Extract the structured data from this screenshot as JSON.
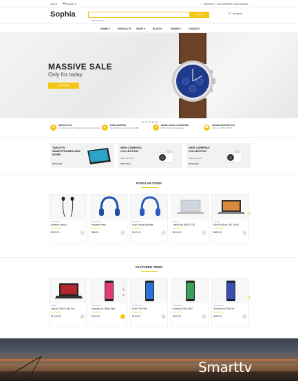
{
  "topbar": {
    "currency": "USD",
    "language": "English",
    "wishlist": "WISHLIST",
    "compare": "COMPARE",
    "account": "My Account"
  },
  "header": {
    "logo": "Sophia",
    "search_placeholder": "Type to search",
    "search_button": "SEARCH",
    "cart": "$1,280.00"
  },
  "nav": {
    "items": [
      "HOME",
      "PRODUCTS",
      "SHOP",
      "BLOG",
      "PAGES",
      "CONTACT"
    ]
  },
  "hero": {
    "title": "MASSIVE SALE",
    "subtitle": "Only for today",
    "button": "SHOP NOW"
  },
  "features": [
    {
      "title": "BONUS PLUS",
      "desc": "Get a bonus plus for buying more than three products",
      "icon": "bonus-icon"
    },
    {
      "title": "FREE SHIPPING",
      "desc": "Free shipping on all orders over $99",
      "icon": "truck-icon"
    },
    {
      "title": "MONEY BACK GUARANTEE",
      "desc": "100% money back guarantee",
      "icon": "money-icon"
    },
    {
      "title": "ONLINE SUPPORT 24/7",
      "desc": "Call us: +1 800 123 4567",
      "icon": "support-icon"
    }
  ],
  "banners": [
    {
      "title": "TABLETS, SMARTPHONES AND MORE",
      "subtitle": "",
      "link": "Shop Now"
    },
    {
      "title": "NEW CAMERAS COLLECTION",
      "subtitle": "Sale up to 30%",
      "link": "Shop Now"
    },
    {
      "title": "NEW CAMERAS COLLECTION",
      "subtitle": "Sale up to 30%",
      "link": "Shop Now"
    }
  ],
  "popular": {
    "title": "POPULAR ITEMS",
    "items": [
      {
        "category": "Headphones",
        "name": "Wireless Mondo",
        "stars": "★★★★★",
        "price": "$200.00"
      },
      {
        "category": "Headphones",
        "name": "Headset Pemo",
        "stars": "★★★★★",
        "price": "$88.00"
      },
      {
        "category": "Headphones",
        "name": "Sono Purple Wireless",
        "stars": "★★★★★",
        "price": "$100.00"
      },
      {
        "category": "Laptops",
        "name": "Tablet Nell 8500U 3TB",
        "stars": "★★★★★",
        "price": "$100.00"
      },
      {
        "category": "Laptops",
        "name": "Elite Pro Book 15'6 7500U",
        "stars": "★★★★★",
        "price": "$850.00"
      }
    ]
  },
  "featured": {
    "title": "FEATURED ITEMS",
    "items": [
      {
        "category": "Laptops",
        "name": "Laptop X53000 with Sm...",
        "stars": "★★★★★",
        "price": "$1,200.00"
      },
      {
        "category": "Smartphones",
        "name": "Smartphone Tablet Spm...",
        "stars": "★★★★★",
        "price": "$400.00"
      },
      {
        "category": "Smartphones",
        "name": "Extra Thin Elite",
        "stars": "★★★★★",
        "price": "$100.00"
      },
      {
        "category": "Smartphones",
        "name": "Notebook Pnlo 4600",
        "stars": "★★★★★",
        "price": "$299.00"
      },
      {
        "category": "Smartphones",
        "name": "Smartphone Elite Pro",
        "stars": "★★★★★",
        "price": "$699.00"
      }
    ]
  },
  "smarttv": {
    "title": "Smarttv"
  },
  "colors": {
    "accent": "#f5c518",
    "watch_dial": "#1f3a8a"
  }
}
